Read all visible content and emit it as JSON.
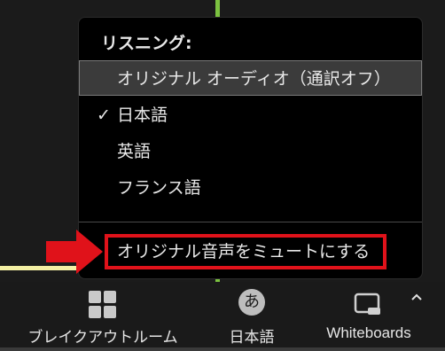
{
  "menu": {
    "header": "リスニング:",
    "items": [
      {
        "label": "オリジナル オーディオ（通訳オフ）",
        "checked": false,
        "highlighted": true
      },
      {
        "label": "日本語",
        "checked": true,
        "highlighted": false
      },
      {
        "label": "英語",
        "checked": false,
        "highlighted": false
      },
      {
        "label": "フランス語",
        "checked": false,
        "highlighted": false
      }
    ],
    "check_mark": "✓",
    "mute_label": "オリジナル音声をミュートにする"
  },
  "toolbar": {
    "breakout_label": "ブレイクアウトルーム",
    "language_label": "日本語",
    "language_icon_glyph": "あ",
    "whiteboards_label": "Whiteboards"
  },
  "icons": {
    "breakout": "grid-icon",
    "language": "language-icon",
    "whiteboards": "whiteboard-icon",
    "more": "chevron-up-icon",
    "annotation": "red-arrow-icon"
  },
  "colors": {
    "highlight_box": "#e0121a",
    "arrow": "#e0121a",
    "accent_green": "#7cc240",
    "accent_yellow": "#f4f0a4"
  }
}
